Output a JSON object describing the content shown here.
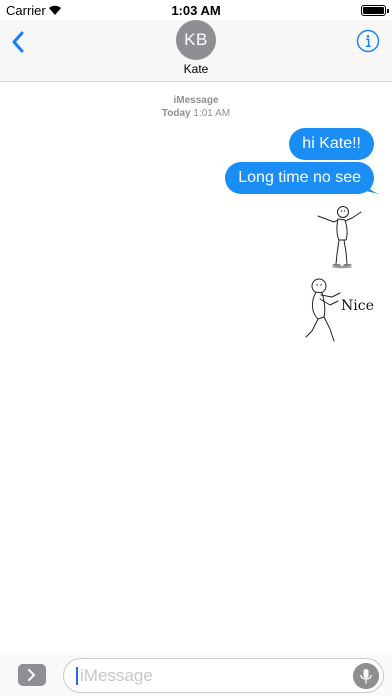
{
  "status_bar": {
    "carrier": "Carrier",
    "time": "1:03 AM"
  },
  "header": {
    "avatar_initials": "KB",
    "contact_name": "Kate"
  },
  "conversation": {
    "service": "iMessage",
    "day": "Today",
    "time": "1:01 AM",
    "messages": [
      {
        "text": "hi Kate!!"
      },
      {
        "text": "Long time no see"
      }
    ],
    "stickers": [
      {
        "name": "dancing-stick-figure"
      },
      {
        "name": "nice-stick-figure",
        "caption": "Nice"
      }
    ]
  },
  "input": {
    "placeholder": "iMessage"
  },
  "colors": {
    "bubble": "#1b8ef5",
    "tint": "#157efb"
  }
}
